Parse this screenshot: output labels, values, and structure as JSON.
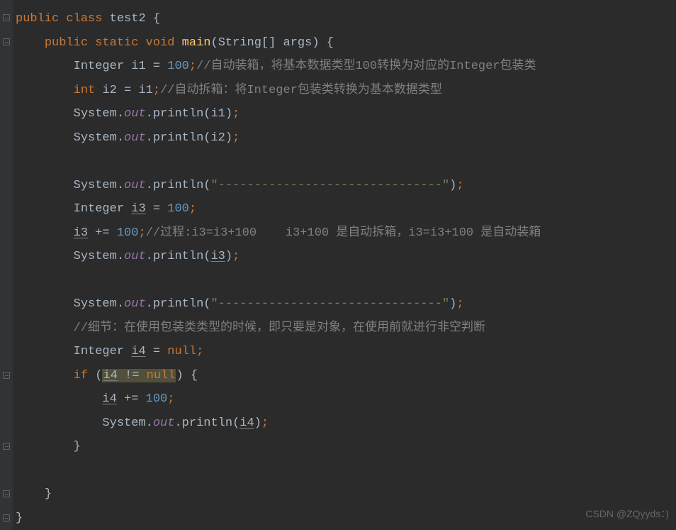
{
  "code": {
    "l1_kw1": "public",
    "l1_kw2": "class",
    "l1_name": "test2",
    "l1_brace": " {",
    "l2_kw1": "public",
    "l2_kw2": "static",
    "l2_kw3": "void",
    "l2_method": "main",
    "l2_params_open": "(",
    "l2_params": "String[] args",
    "l2_params_close": ") {",
    "l3_type": "Integer ",
    "l3_var": "i1 = ",
    "l3_val": "100",
    "l3_semi": ";",
    "l3_comment": "//自动装箱，将基本数据类型100转换为对应的Integer包装类",
    "l4_type": "int ",
    "l4_var": "i2 = i1",
    "l4_semi": ";",
    "l4_comment": "//自动拆箱：将Integer包装类转换为基本数据类型",
    "l5_sys": "System.",
    "l5_out": "out",
    "l5_call": ".println(i1)",
    "l5_semi": ";",
    "l6_sys": "System.",
    "l6_out": "out",
    "l6_call": ".println(i2)",
    "l6_semi": ";",
    "l8_sys": "System.",
    "l8_out": "out",
    "l8_call": ".println(",
    "l8_str": "\"-------------------------------\"",
    "l8_close": ")",
    "l8_semi": ";",
    "l9_type": "Integer ",
    "l9_var": "i3",
    "l9_eq": " = ",
    "l9_val": "100",
    "l9_semi": ";",
    "l10_var": "i3",
    "l10_op": " += ",
    "l10_val": "100",
    "l10_semi": ";",
    "l10_comment": "//过程:i3=i3+100    i3+100 是自动拆箱，i3=i3+100 是自动装箱",
    "l11_sys": "System.",
    "l11_out": "out",
    "l11_call1": ".println(",
    "l11_var": "i3",
    "l11_call2": ")",
    "l11_semi": ";",
    "l13_sys": "System.",
    "l13_out": "out",
    "l13_call": ".println(",
    "l13_str": "\"-------------------------------\"",
    "l13_close": ")",
    "l13_semi": ";",
    "l14_comment": "//细节：在使用包装类类型的时候，即只要是对象，在使用前就进行非空判断",
    "l15_type": "Integer ",
    "l15_var": "i4",
    "l15_eq": " = ",
    "l15_val": "null",
    "l15_semi": ";",
    "l16_if": "if",
    "l16_open": " (",
    "l16_cond_var": "i4",
    "l16_cond_op": " != ",
    "l16_cond_null": "null",
    "l16_close": ") {",
    "l17_var": "i4",
    "l17_op": " += ",
    "l17_val": "100",
    "l17_semi": ";",
    "l18_sys": "System.",
    "l18_out": "out",
    "l18_call1": ".println(",
    "l18_var": "i4",
    "l18_call2": ")",
    "l18_semi": ";",
    "l19_brace": "}",
    "l21_brace": "}",
    "l22_brace": "}"
  },
  "watermark": "CSDN @ZQyyds：)"
}
